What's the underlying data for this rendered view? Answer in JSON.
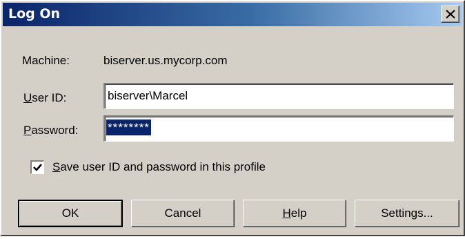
{
  "window": {
    "title": "Log On"
  },
  "machine": {
    "label": "Machine:",
    "value": "biserver.us.mycorp.com"
  },
  "user_id": {
    "label_mnemonic": "U",
    "label_rest": "ser ID:",
    "value": "biserver\\Marcel"
  },
  "password": {
    "label_mnemonic": "P",
    "label_rest": "assword:",
    "value": "********"
  },
  "save_checkbox": {
    "checked": true,
    "label_mnemonic": "S",
    "label_rest": "ave user ID and password in this profile"
  },
  "buttons": {
    "ok": "OK",
    "cancel": "Cancel",
    "help_mnemonic": "H",
    "help_rest": "elp",
    "settings": "Settings..."
  },
  "colors": {
    "titlebar_start": "#0a246a",
    "titlebar_end": "#a6caf0",
    "dialog_bg": "#d4d0c8",
    "selection": "#0a246a"
  }
}
